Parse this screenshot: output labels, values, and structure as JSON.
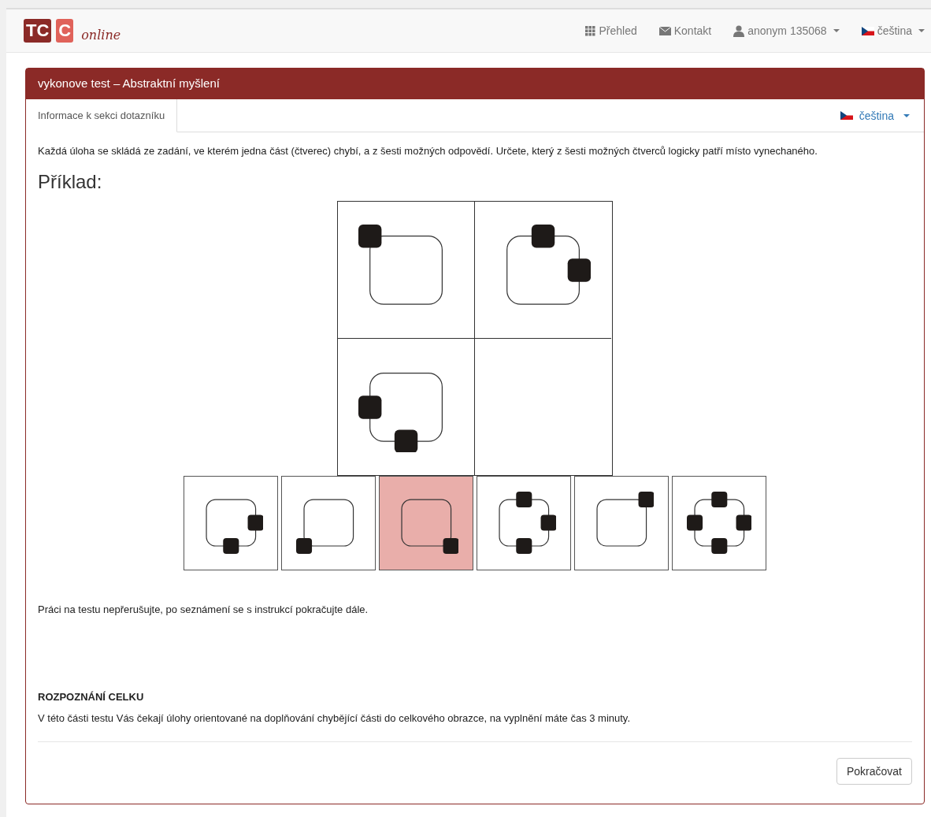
{
  "navbar": {
    "logo": {
      "letters": [
        "TC",
        "C"
      ],
      "tagline": "online"
    },
    "items": [
      {
        "kind": "grid",
        "label": "Přehled"
      },
      {
        "kind": "mail",
        "label": "Kontakt"
      },
      {
        "kind": "user",
        "label": "anonym 135068"
      },
      {
        "kind": "flag",
        "label": "čeština"
      }
    ]
  },
  "panel": {
    "title": "vykonove test – Abstraktní myšlení",
    "tabs": [
      {
        "label": "Informace k sekci dotazníku",
        "selected": true
      }
    ],
    "language": {
      "label": "čeština"
    },
    "intro": "Každá úloha se skládá ze zadání, ve kterém jedna část (čtverec) chybí, a z šesti možných odpovědí. Určete, který z šesti možných čtverců logicky patří místo vynechaného.",
    "example_heading": "Příklad:",
    "answer_options": [
      {
        "selected": false
      },
      {
        "selected": false
      },
      {
        "selected": true
      },
      {
        "selected": false
      },
      {
        "selected": false
      },
      {
        "selected": false
      }
    ],
    "note": "Práci na testu nepřerušujte, po seznámení se s instrukcí pokračujte dále.",
    "section_heading": "ROZPOZNÁNÍ CELKU",
    "section_text": "V této části testu Vás čekají úlohy orientované na doplňování chybějící části do celkového obrazce, na vyplnění máte čas 3 minuty.",
    "continue_button": "Pokračovat"
  }
}
